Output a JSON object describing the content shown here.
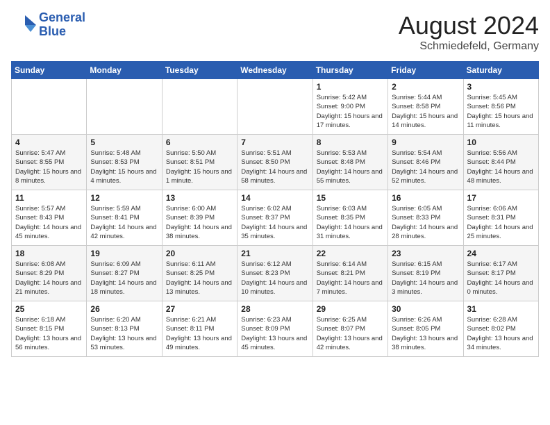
{
  "header": {
    "logo_line1": "General",
    "logo_line2": "Blue",
    "month_year": "August 2024",
    "location": "Schmiedefeld, Germany"
  },
  "days_of_week": [
    "Sunday",
    "Monday",
    "Tuesday",
    "Wednesday",
    "Thursday",
    "Friday",
    "Saturday"
  ],
  "weeks": [
    [
      {
        "day": "",
        "info": ""
      },
      {
        "day": "",
        "info": ""
      },
      {
        "day": "",
        "info": ""
      },
      {
        "day": "",
        "info": ""
      },
      {
        "day": "1",
        "info": "Sunrise: 5:42 AM\nSunset: 9:00 PM\nDaylight: 15 hours and 17 minutes."
      },
      {
        "day": "2",
        "info": "Sunrise: 5:44 AM\nSunset: 8:58 PM\nDaylight: 15 hours and 14 minutes."
      },
      {
        "day": "3",
        "info": "Sunrise: 5:45 AM\nSunset: 8:56 PM\nDaylight: 15 hours and 11 minutes."
      }
    ],
    [
      {
        "day": "4",
        "info": "Sunrise: 5:47 AM\nSunset: 8:55 PM\nDaylight: 15 hours and 8 minutes."
      },
      {
        "day": "5",
        "info": "Sunrise: 5:48 AM\nSunset: 8:53 PM\nDaylight: 15 hours and 4 minutes."
      },
      {
        "day": "6",
        "info": "Sunrise: 5:50 AM\nSunset: 8:51 PM\nDaylight: 15 hours and 1 minute."
      },
      {
        "day": "7",
        "info": "Sunrise: 5:51 AM\nSunset: 8:50 PM\nDaylight: 14 hours and 58 minutes."
      },
      {
        "day": "8",
        "info": "Sunrise: 5:53 AM\nSunset: 8:48 PM\nDaylight: 14 hours and 55 minutes."
      },
      {
        "day": "9",
        "info": "Sunrise: 5:54 AM\nSunset: 8:46 PM\nDaylight: 14 hours and 52 minutes."
      },
      {
        "day": "10",
        "info": "Sunrise: 5:56 AM\nSunset: 8:44 PM\nDaylight: 14 hours and 48 minutes."
      }
    ],
    [
      {
        "day": "11",
        "info": "Sunrise: 5:57 AM\nSunset: 8:43 PM\nDaylight: 14 hours and 45 minutes."
      },
      {
        "day": "12",
        "info": "Sunrise: 5:59 AM\nSunset: 8:41 PM\nDaylight: 14 hours and 42 minutes."
      },
      {
        "day": "13",
        "info": "Sunrise: 6:00 AM\nSunset: 8:39 PM\nDaylight: 14 hours and 38 minutes."
      },
      {
        "day": "14",
        "info": "Sunrise: 6:02 AM\nSunset: 8:37 PM\nDaylight: 14 hours and 35 minutes."
      },
      {
        "day": "15",
        "info": "Sunrise: 6:03 AM\nSunset: 8:35 PM\nDaylight: 14 hours and 31 minutes."
      },
      {
        "day": "16",
        "info": "Sunrise: 6:05 AM\nSunset: 8:33 PM\nDaylight: 14 hours and 28 minutes."
      },
      {
        "day": "17",
        "info": "Sunrise: 6:06 AM\nSunset: 8:31 PM\nDaylight: 14 hours and 25 minutes."
      }
    ],
    [
      {
        "day": "18",
        "info": "Sunrise: 6:08 AM\nSunset: 8:29 PM\nDaylight: 14 hours and 21 minutes."
      },
      {
        "day": "19",
        "info": "Sunrise: 6:09 AM\nSunset: 8:27 PM\nDaylight: 14 hours and 18 minutes."
      },
      {
        "day": "20",
        "info": "Sunrise: 6:11 AM\nSunset: 8:25 PM\nDaylight: 14 hours and 13 minutes."
      },
      {
        "day": "21",
        "info": "Sunrise: 6:12 AM\nSunset: 8:23 PM\nDaylight: 14 hours and 10 minutes."
      },
      {
        "day": "22",
        "info": "Sunrise: 6:14 AM\nSunset: 8:21 PM\nDaylight: 14 hours and 7 minutes."
      },
      {
        "day": "23",
        "info": "Sunrise: 6:15 AM\nSunset: 8:19 PM\nDaylight: 14 hours and 3 minutes."
      },
      {
        "day": "24",
        "info": "Sunrise: 6:17 AM\nSunset: 8:17 PM\nDaylight: 14 hours and 0 minutes."
      }
    ],
    [
      {
        "day": "25",
        "info": "Sunrise: 6:18 AM\nSunset: 8:15 PM\nDaylight: 13 hours and 56 minutes."
      },
      {
        "day": "26",
        "info": "Sunrise: 6:20 AM\nSunset: 8:13 PM\nDaylight: 13 hours and 53 minutes."
      },
      {
        "day": "27",
        "info": "Sunrise: 6:21 AM\nSunset: 8:11 PM\nDaylight: 13 hours and 49 minutes."
      },
      {
        "day": "28",
        "info": "Sunrise: 6:23 AM\nSunset: 8:09 PM\nDaylight: 13 hours and 45 minutes."
      },
      {
        "day": "29",
        "info": "Sunrise: 6:25 AM\nSunset: 8:07 PM\nDaylight: 13 hours and 42 minutes."
      },
      {
        "day": "30",
        "info": "Sunrise: 6:26 AM\nSunset: 8:05 PM\nDaylight: 13 hours and 38 minutes."
      },
      {
        "day": "31",
        "info": "Sunrise: 6:28 AM\nSunset: 8:02 PM\nDaylight: 13 hours and 34 minutes."
      }
    ]
  ]
}
